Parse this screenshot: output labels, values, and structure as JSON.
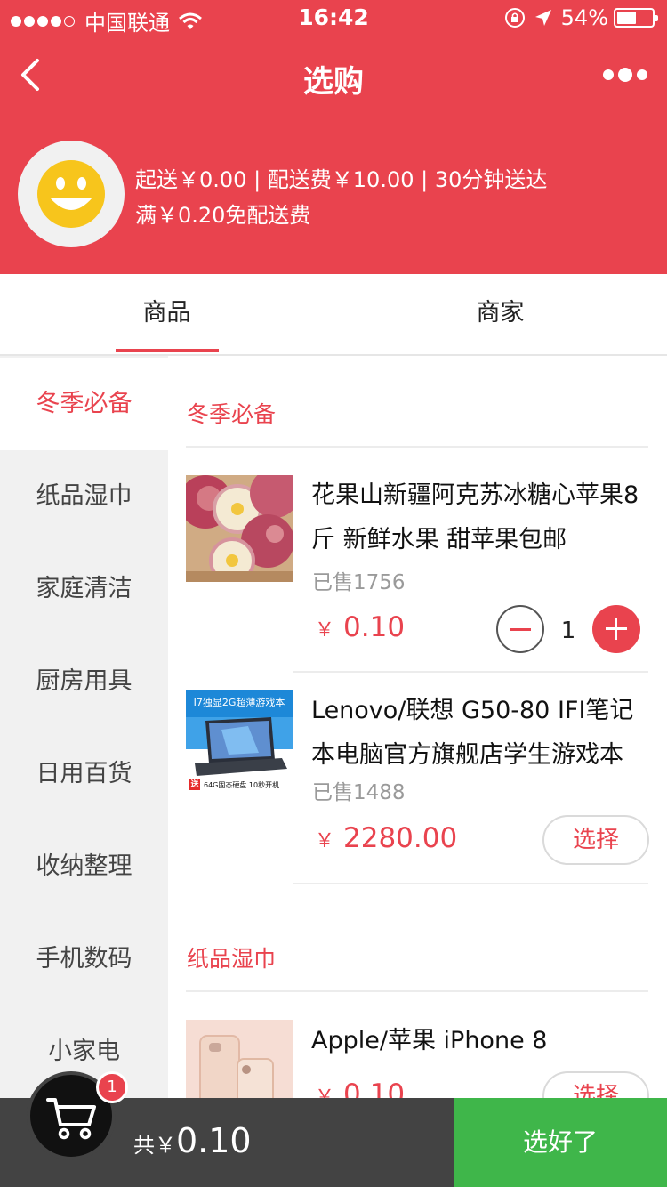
{
  "status_bar": {
    "carrier": "中国联通",
    "time": "16:42",
    "battery_percent": "54%",
    "battery_level": 0.54,
    "icons": [
      "signal-dots-icon",
      "wifi-icon",
      "rotation-lock-icon",
      "location-arrow-icon",
      "battery-icon"
    ]
  },
  "nav": {
    "title": "选购",
    "back_icon": "chevron-left-icon",
    "more_icon": "more-dots-icon"
  },
  "shop": {
    "avatar_icon": "smiley-face-icon",
    "info_line1": "起送￥0.00 | 配送费￥10.00 | 30分钟送达",
    "info_line2": "满￥0.20免配送费"
  },
  "tabs": [
    {
      "label": "商品",
      "active": true
    },
    {
      "label": "商家",
      "active": false
    }
  ],
  "categories": [
    {
      "label": "冬季必备",
      "active": true
    },
    {
      "label": "纸品湿巾",
      "active": false
    },
    {
      "label": "家庭清洁",
      "active": false
    },
    {
      "label": "厨房用具",
      "active": false
    },
    {
      "label": "日用百货",
      "active": false
    },
    {
      "label": "收纳整理",
      "active": false
    },
    {
      "label": "手机数码",
      "active": false
    },
    {
      "label": "小家电",
      "active": false
    }
  ],
  "sections": [
    {
      "title": "冬季必备",
      "products": [
        {
          "name": "花果山新疆阿克苏冰糖心苹果8斤 新鲜水果 甜苹果包邮",
          "sold": "已售1756",
          "currency": "￥",
          "price": "0.10",
          "quantity": "1"
        },
        {
          "name": "Lenovo/联想 G50-80 IFI笔记本电脑官方旗舰店学生游戏本",
          "sold": "已售1488",
          "currency": "￥",
          "price": "2280.00",
          "choose_label": "选择",
          "thumb_banner": "I7独显2G超薄游戏本",
          "thumb_promo_badge": "送",
          "thumb_promo": "64G固态硬盘 10秒开机"
        }
      ]
    },
    {
      "title": "纸品湿巾",
      "products": [
        {
          "name": "Apple/苹果 iPhone 8",
          "currency": "￥",
          "price": "0.10",
          "choose_label": "选择"
        }
      ]
    }
  ],
  "cart": {
    "icon": "shopping-cart-icon",
    "badge_count": "1",
    "total_prefix": "共￥",
    "total_amount": "0.10",
    "confirm_label": "选好了"
  },
  "colors": {
    "brand_red": "#e9434e",
    "confirm_green": "#3fb64a",
    "bottom_bar": "#434343",
    "sidebar_bg": "#f1f1f1"
  }
}
